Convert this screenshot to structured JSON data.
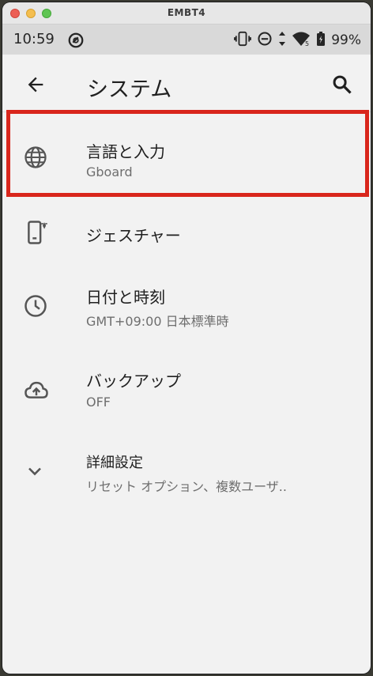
{
  "window": {
    "title": "EMBT4"
  },
  "statusbar": {
    "time": "10:59",
    "battery": "99%"
  },
  "appbar": {
    "title": "システム"
  },
  "items": [
    {
      "title": "言語と入力",
      "subtitle": "Gboard",
      "icon": "globe-icon"
    },
    {
      "title": "ジェスチャー",
      "subtitle": "",
      "icon": "phone-gesture-icon"
    },
    {
      "title": "日付と時刻",
      "subtitle": "GMT+09:00 日本標準時",
      "icon": "clock-icon"
    },
    {
      "title": "バックアップ",
      "subtitle": "OFF",
      "icon": "cloud-upload-icon"
    },
    {
      "title": "詳細設定",
      "subtitle": "リセット オプション、複数ユーザ..",
      "icon": "chevron-down-icon"
    }
  ],
  "colors": {
    "highlight": "#d9261c",
    "accent": "#202020"
  }
}
